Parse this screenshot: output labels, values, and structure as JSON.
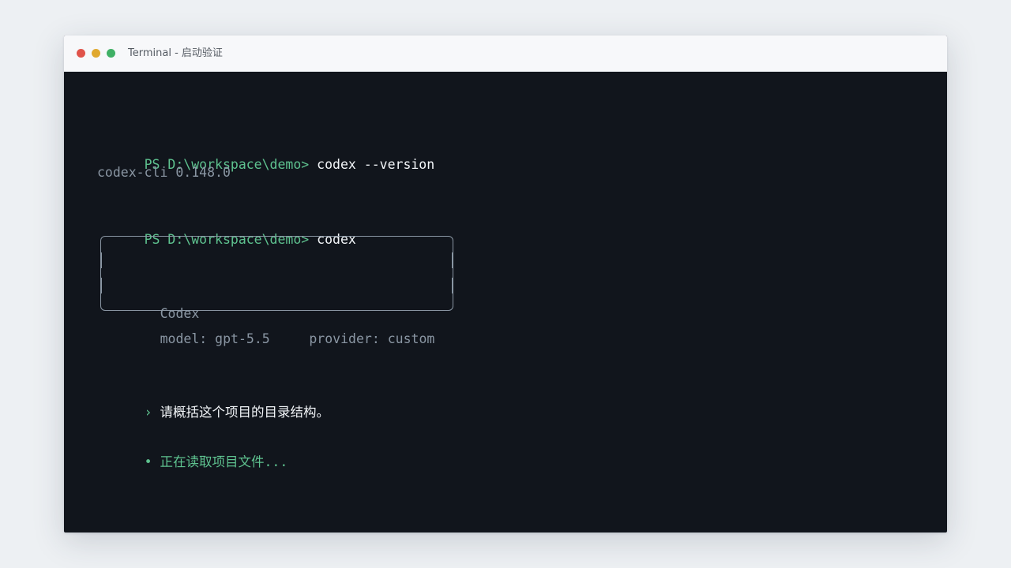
{
  "window": {
    "title": "Terminal - 启动验证",
    "controls": {
      "close_color": "#e0534a",
      "minimize_color": "#e0a82e",
      "maximize_color": "#3fb065"
    }
  },
  "terminal": {
    "block1": {
      "prompt": "PS D:\\workspace\\demo>",
      "command": "codex --version",
      "output": "codex-cli 0.148.0"
    },
    "block2": {
      "prompt": "PS D:\\workspace\\demo>",
      "command": "codex"
    },
    "banner": {
      "title": "Codex",
      "model_label": "model:",
      "model_value": "gpt-5.5",
      "provider_label": "provider:",
      "provider_value": "custom"
    },
    "user_input": {
      "marker": "›",
      "text": "请概括这个项目的目录结构。"
    },
    "status": {
      "marker": "•",
      "text": "正在读取项目文件..."
    }
  }
}
